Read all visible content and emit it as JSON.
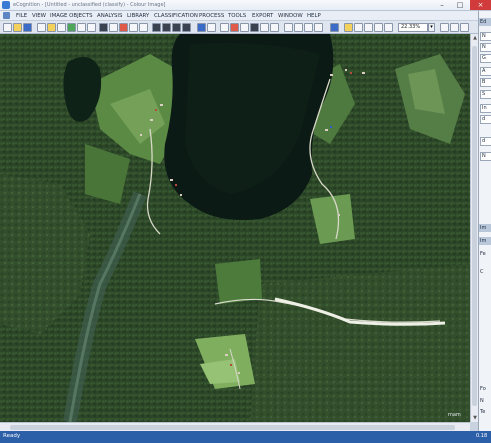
{
  "window": {
    "title": "eCognition - [Untitled - unclassified (classify) - Colour Image]"
  },
  "menu": {
    "items": [
      {
        "label": "FILE"
      },
      {
        "label": "VIEW"
      },
      {
        "label": "IMAGE OBJECTS"
      },
      {
        "label": "ANALYSIS"
      },
      {
        "label": "LIBRARY"
      },
      {
        "label": "CLASSIFICATION"
      },
      {
        "label": "PROCESS"
      },
      {
        "label": "TOOLS"
      },
      {
        "label": "EXPORT"
      },
      {
        "label": "WINDOW"
      },
      {
        "label": "HELP"
      }
    ]
  },
  "toolbar": {
    "zoom_value": "22.33%",
    "zoom_dropdown": "▾"
  },
  "map": {
    "credit": "mam"
  },
  "sidepanel": {
    "tab_edit": "Ed",
    "rows": [
      "N",
      "N",
      "G",
      "A",
      "B",
      "S",
      "In",
      "d",
      "d",
      "N"
    ],
    "section_header": "Im",
    "labels": [
      "Fe",
      "Im",
      "C"
    ],
    "lower_rows": [
      "Fo",
      "N",
      "Te"
    ]
  },
  "status": {
    "text": "Ready",
    "coord": "0.18"
  }
}
